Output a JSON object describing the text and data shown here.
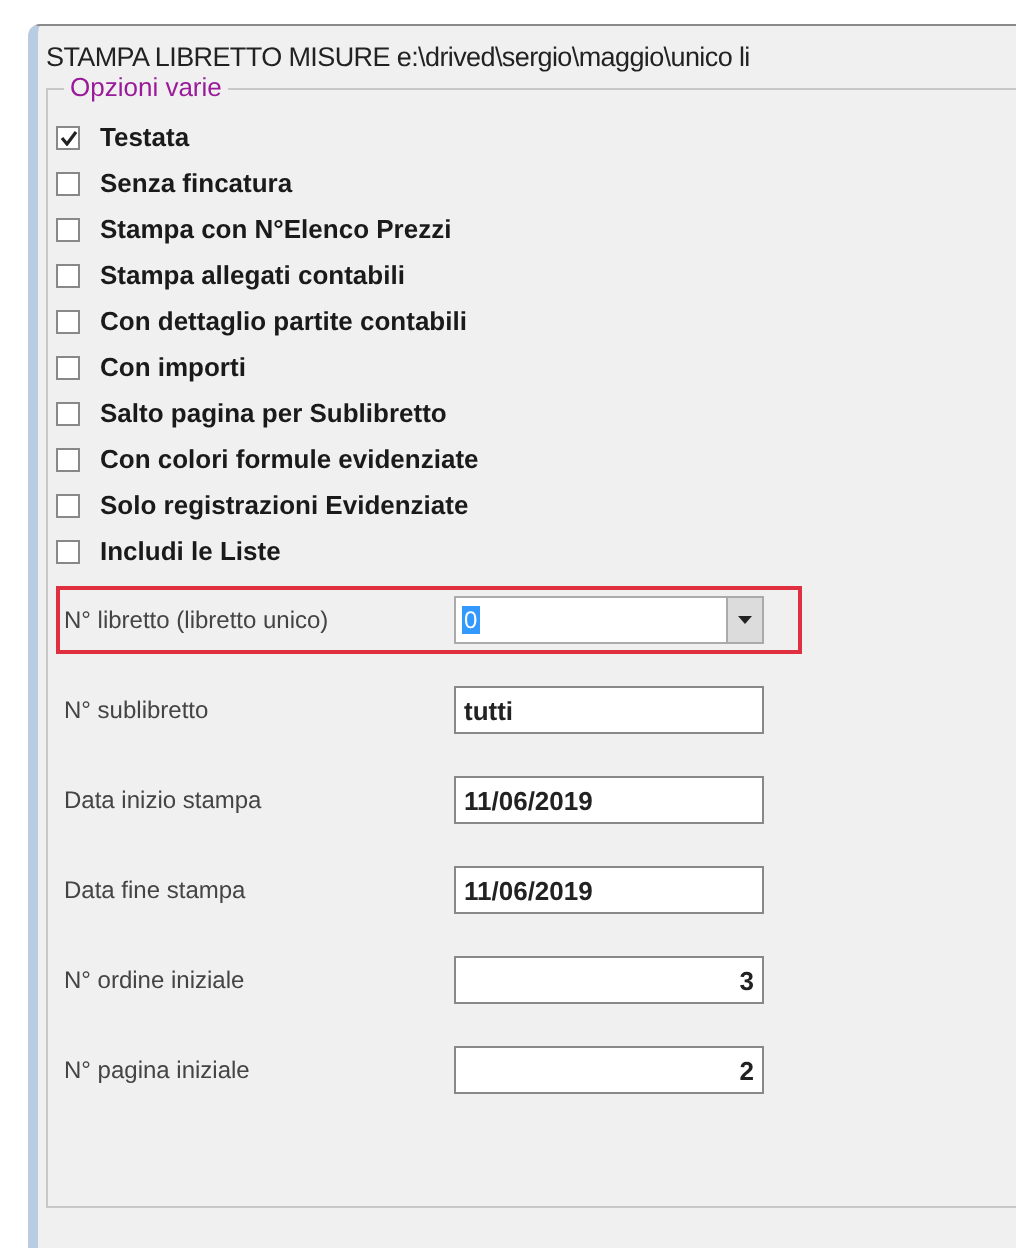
{
  "window": {
    "title": "STAMPA   LIBRETTO MISURE  e:\\drived\\sergio\\maggio\\unico li"
  },
  "group": {
    "title": "Opzioni varie",
    "options": [
      {
        "label": "Testata",
        "checked": true
      },
      {
        "label": "Senza fincatura",
        "checked": false
      },
      {
        "label": "Stampa con N°Elenco Prezzi",
        "checked": false
      },
      {
        "label": "Stampa allegati contabili",
        "checked": false
      },
      {
        "label": "Con dettaglio partite contabili",
        "checked": false
      },
      {
        "label": "Con importi",
        "checked": false
      },
      {
        "label": "Salto pagina per Sublibretto",
        "checked": false
      },
      {
        "label": "Con colori formule evidenziate",
        "checked": false
      },
      {
        "label": "Solo registrazioni Evidenziate",
        "checked": false
      },
      {
        "label": "Includi le Liste",
        "checked": false
      }
    ],
    "fields": [
      {
        "label": "N° libretto (libretto unico)",
        "kind": "combo",
        "value": "0",
        "highlighted": true
      },
      {
        "label": "N° sublibretto",
        "kind": "text",
        "value": "tutti",
        "highlighted": false
      },
      {
        "label": "Data inizio stampa",
        "kind": "text",
        "value": "11/06/2019",
        "highlighted": false
      },
      {
        "label": "Data fine stampa",
        "kind": "text",
        "value": "11/06/2019",
        "highlighted": false
      },
      {
        "label": "N° ordine iniziale",
        "kind": "number",
        "value": "3",
        "highlighted": false
      },
      {
        "label": "N° pagina iniziale",
        "kind": "number",
        "value": "2",
        "highlighted": false
      }
    ]
  }
}
